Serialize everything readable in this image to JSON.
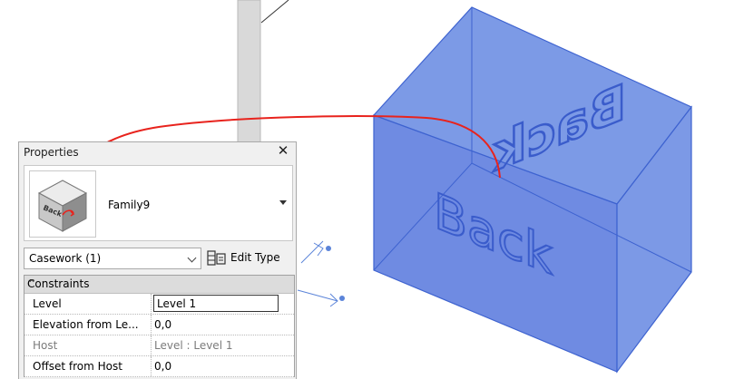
{
  "viewport": {
    "model_text": "Back",
    "model_color": "#5b7fe0",
    "annotation_color": "#e8231d"
  },
  "properties": {
    "title": "Properties",
    "close_icon": "close-icon",
    "type_selector": {
      "family_name": "Family9",
      "preview_text": "Back"
    },
    "filter": {
      "selected": "Casework (1)"
    },
    "edit_type_label": "Edit Type",
    "groups": [
      {
        "name": "Constraints",
        "rows": [
          {
            "name": "Level",
            "value": "Level 1",
            "editable": true
          },
          {
            "name": "Elevation from Le...",
            "value": "0,0",
            "editable": false
          },
          {
            "name": "Host",
            "value": "Level : Level 1",
            "editable": false,
            "disabled": true
          },
          {
            "name": "Offset from Host",
            "value": "0,0",
            "editable": false
          }
        ]
      }
    ]
  }
}
